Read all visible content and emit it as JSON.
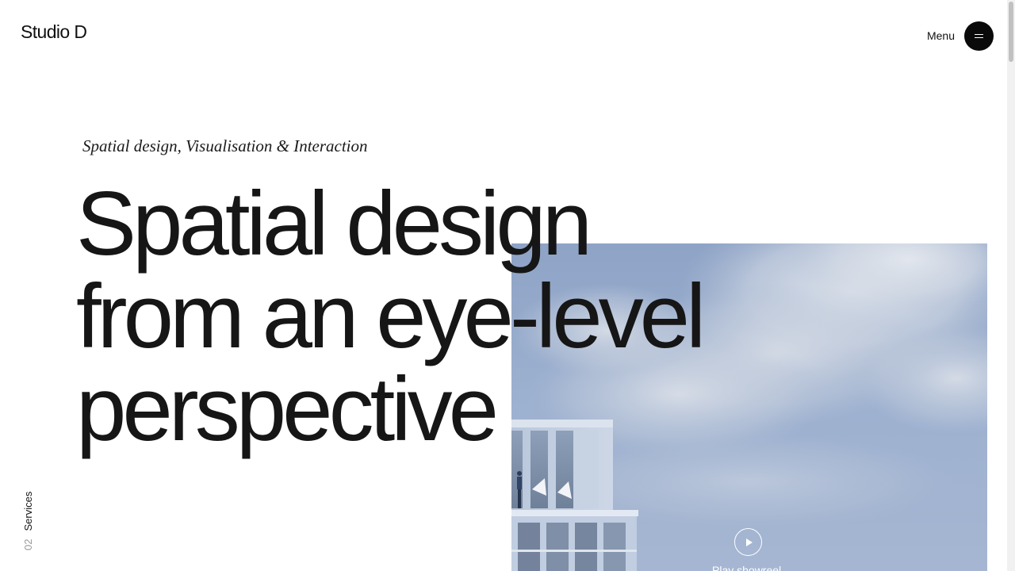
{
  "header": {
    "logo": "Studio D",
    "menu_label": "Menu"
  },
  "hero": {
    "eyebrow": "Spatial design, Visualisation & Interaction",
    "title_lines": [
      "Spatial design",
      "from an eye-level",
      "perspective"
    ],
    "play_label": "Play showreel"
  },
  "section_indicator": {
    "number": "02",
    "name": "Services"
  },
  "icons": {
    "menu": "hamburger-icon",
    "play": "play-icon"
  },
  "colors": {
    "background": "#ffffff",
    "text": "#161616",
    "menu_button": "#0a0a0a",
    "muted": "#9a9a9a",
    "sky": "#9db0cf"
  }
}
